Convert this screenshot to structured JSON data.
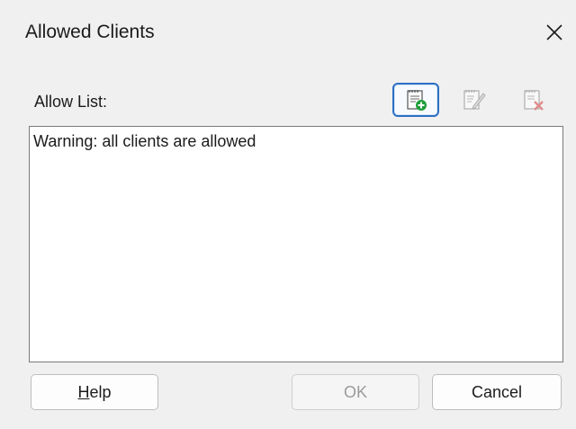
{
  "window": {
    "title": "Allowed Clients",
    "close_glyph": "×"
  },
  "allow_list": {
    "label": "Allow List:",
    "items": [
      "Warning: all clients are allowed"
    ]
  },
  "toolbar": {
    "add_icon": "add-entry-icon",
    "edit_icon": "edit-entry-icon",
    "remove_icon": "remove-entry-icon"
  },
  "buttons": {
    "help_mnemonic": "H",
    "help_rest": "elp",
    "ok": "OK",
    "cancel": "Cancel"
  },
  "colors": {
    "accent": "#2d6fc2",
    "add_green": "#1e9e3a",
    "remove_red": "#d23b3b",
    "disabled_text": "#9b9b9b"
  }
}
